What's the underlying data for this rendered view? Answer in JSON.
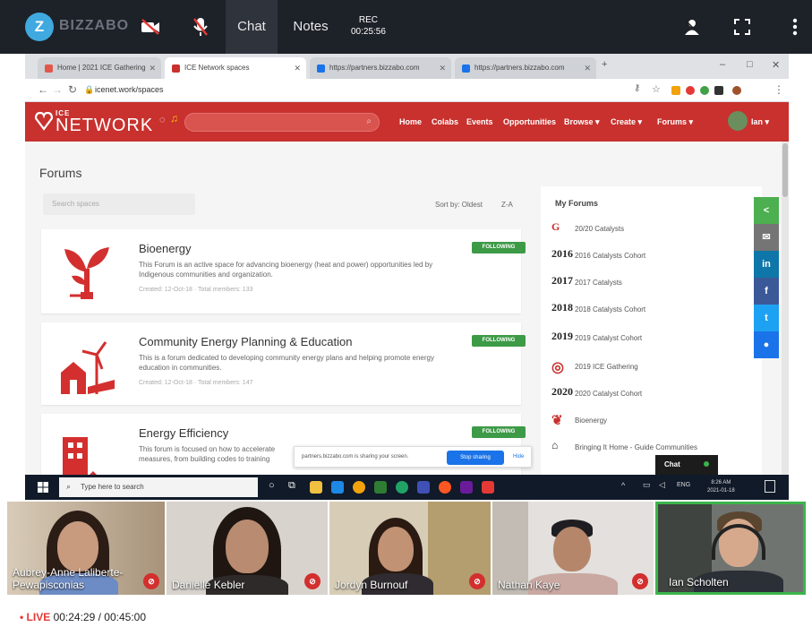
{
  "topbar": {
    "logo_letter": "Z",
    "logo_text": "BIZZABO",
    "tabs": [
      {
        "label": "Chat",
        "active": true
      },
      {
        "label": "Notes",
        "active": false
      }
    ],
    "rec_label": "REC",
    "rec_time": "00:25:56",
    "icons": [
      "camera-off-icon",
      "mic-off-icon",
      "person-icon",
      "fullscreen-icon",
      "more-vertical-icon"
    ]
  },
  "browser": {
    "tabs": [
      {
        "title": "Home | 2021 ICE Gathering",
        "color": "#e2574c"
      },
      {
        "title": "ICE Network spaces",
        "color": "#c8312e"
      },
      {
        "title": "https://partners.bizzabo.com",
        "color": "#1a73e8"
      },
      {
        "title": "https://partners.bizzabo.com",
        "color": "#1a73e8"
      }
    ],
    "url": "icenet.work/spaces"
  },
  "ice_nav": {
    "logo_small": "ICE",
    "logo": "NETWORK",
    "links": [
      "Home",
      "Colabs",
      "Events",
      "Opportunities",
      "Browse ▾",
      "Create ▾",
      "Forums ▾"
    ],
    "user": "Ian ▾"
  },
  "page": {
    "title": "Forums",
    "search_placeholder": "Search spaces",
    "sort_label": "Sort by: Oldest",
    "sort_toggle": "Z-A",
    "forums": [
      {
        "title": "Bioenergy",
        "desc": "This Forum is an active space for advancing bioenergy (heat and power) opportunities led by Indigenous communities and organization.",
        "meta": "Created: 12-Oct-18 · Total members: 133",
        "badge": "FOLLOWING"
      },
      {
        "title": "Community Energy Planning & Education",
        "desc": "This is a forum dedicated to developing community energy plans and helping promote energy education in communities.",
        "meta": "Created: 12-Oct-18 · Total members: 147",
        "badge": "FOLLOWING"
      },
      {
        "title": "Energy Efficiency",
        "desc": "This forum is focused on how to accelerate measures, from building codes to training",
        "meta": "",
        "badge": "FOLLOWING"
      }
    ],
    "my_forums_title": "My Forums",
    "my_forums": [
      {
        "icon": "G",
        "label": "20/20 Catalysts"
      },
      {
        "icon": "2016",
        "label": "2016 Catalysts Cohort"
      },
      {
        "icon": "2017",
        "label": "2017 Catalysts"
      },
      {
        "icon": "2018",
        "label": "2018 Catalysts Cohort"
      },
      {
        "icon": "2019",
        "label": "2019 Catalyst Cohort"
      },
      {
        "icon": "◎",
        "label": "2019 ICE Gathering"
      },
      {
        "icon": "2020",
        "label": "2020 Catalyst Cohort"
      },
      {
        "icon": "❦",
        "label": "Bioenergy"
      },
      {
        "icon": "⌂",
        "label": "Bringing It Home - Guide Communities"
      }
    ],
    "share_buttons": [
      {
        "label": "<",
        "color": "#4caf50"
      },
      {
        "label": "✉",
        "color": "#757575"
      },
      {
        "label": "in",
        "color": "#0e76a8"
      },
      {
        "label": "f",
        "color": "#3b5998"
      },
      {
        "label": "t",
        "color": "#1da1f2"
      },
      {
        "label": "●",
        "color": "#1a73e8"
      }
    ],
    "sharing_msg": "partners.bizzabo.com is sharing your screen.",
    "stop_sharing": "Stop sharing",
    "hide": "Hide",
    "chat_popup": "Chat"
  },
  "taskbar": {
    "search_placeholder": "Type here to search",
    "apps": [
      "#f0c040",
      "#1e88e5",
      "#f2a20c",
      "#2e7d32",
      "#21a366",
      "#3f51b5",
      "#ff5722",
      "#6a1b9a",
      "#e53935"
    ],
    "time": "8:26 AM",
    "date": "2021-01-18",
    "lang": "ENG"
  },
  "participants": [
    {
      "name": "Aubrey-Anne Laliberte-Pewapisconias"
    },
    {
      "name": "Danielle Kebler"
    },
    {
      "name": "Jordyn Burnouf"
    },
    {
      "name": "Nathan Kaye"
    },
    {
      "name": "Ian Scholten"
    }
  ],
  "live": {
    "label": "• LIVE",
    "elapsed": "00:24:29",
    "total": "/ 00:45:00"
  }
}
